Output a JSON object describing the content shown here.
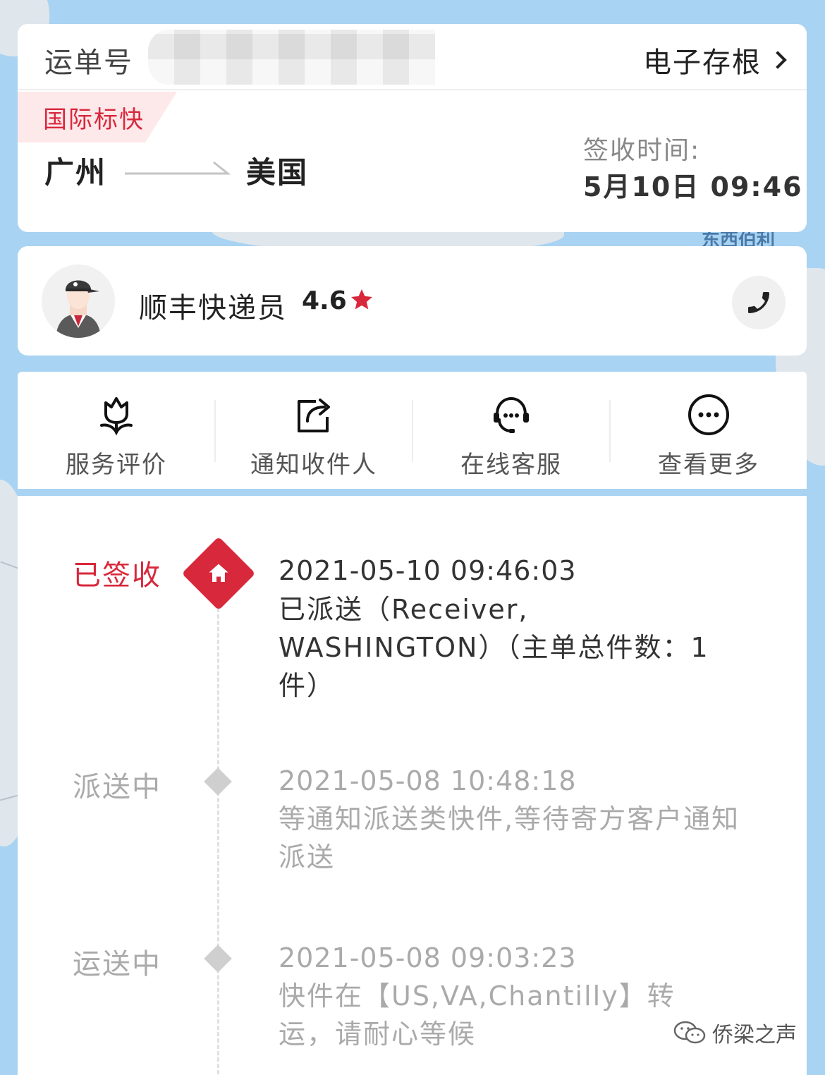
{
  "waybill": {
    "label": "运单号",
    "receipt_link": "电子存根"
  },
  "shipment": {
    "service_badge": "国际标快",
    "origin": "广州",
    "destination": "美国",
    "sign_label": "签收时间:",
    "sign_time": "5月10日 09:46"
  },
  "courier": {
    "name": "顺丰快递员",
    "rating": "4.6"
  },
  "actions": [
    {
      "label": "服务评价",
      "icon": "flower-icon"
    },
    {
      "label": "通知收件人",
      "icon": "share-icon"
    },
    {
      "label": "在线客服",
      "icon": "headset-icon"
    },
    {
      "label": "查看更多",
      "icon": "more-icon"
    }
  ],
  "timeline": [
    {
      "status": "已签收",
      "time": "2021-05-10 09:46:03",
      "desc": "已派送（Receiver, WASHINGTON）（主单总件数：1件）"
    },
    {
      "status": "派送中",
      "time": "2021-05-08 10:48:18",
      "desc": "等通知派送类快件,等待寄方客户通知派送"
    },
    {
      "status": "运送中",
      "time": "2021-05-08 09:03:23",
      "desc": "快件在【US,VA,Chantilly】转运，请耐心等候"
    }
  ],
  "map_label": "东西伯利",
  "watermark": "侨梁之声",
  "colors": {
    "accent_red": "#d8283c",
    "muted_gray": "#aaaaaa",
    "map_water": "#a9d3f2"
  }
}
